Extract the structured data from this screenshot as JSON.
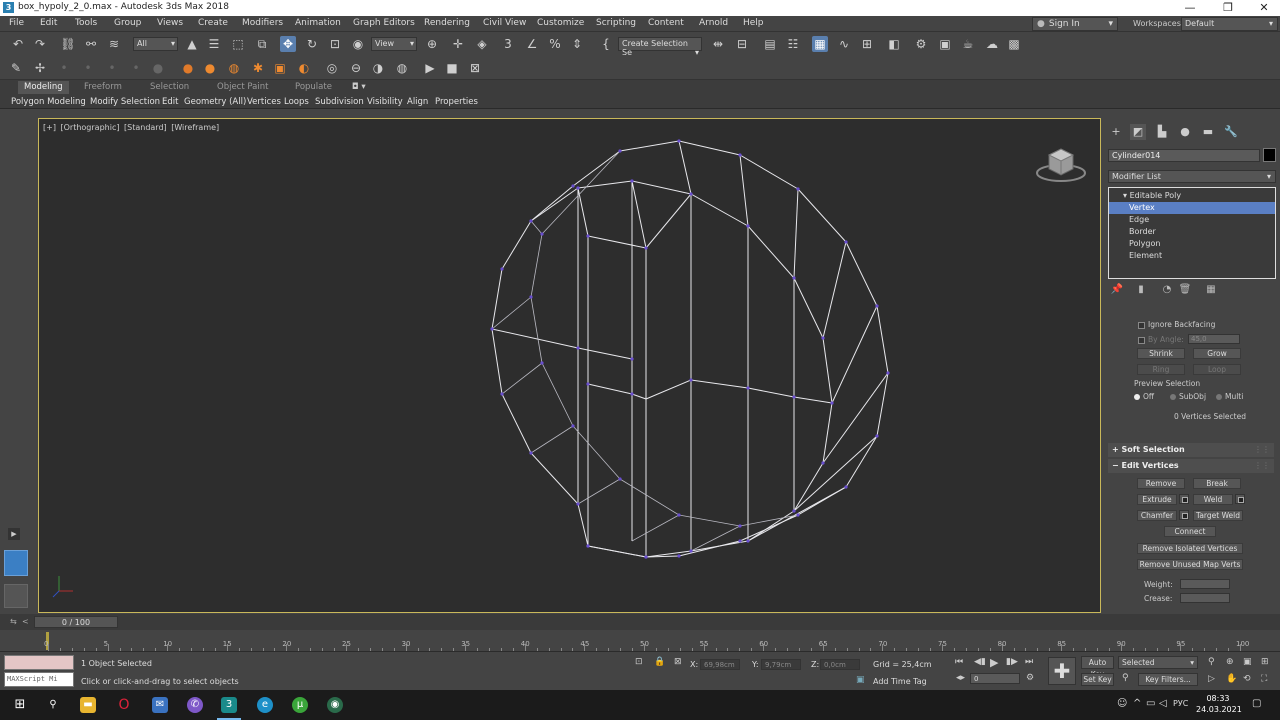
{
  "window": {
    "title": "box_hypoly_2_0.max - Autodesk 3ds Max 2018",
    "app_icon": "3"
  },
  "window_buttons": {
    "minimize": "—",
    "restore": "❐",
    "close": "✕"
  },
  "menu": [
    "File",
    "Edit",
    "Tools",
    "Group",
    "Views",
    "Create",
    "Modifiers",
    "Animation",
    "Graph Editors",
    "Rendering",
    "Civil View",
    "Customize",
    "Scripting",
    "Content",
    "Arnold",
    "Help"
  ],
  "signin": "Sign In",
  "workspaces_label": "Workspaces:",
  "workspace_value": "Default",
  "toolbar": {
    "selection_filter": "All",
    "ref_coord": "View",
    "named_selection": "Create Selection Se"
  },
  "ribbon_tabs": [
    "Modeling",
    "Freeform",
    "Selection",
    "Object Paint",
    "Populate"
  ],
  "ribbon_items": [
    "Polygon Modeling",
    "Modify Selection",
    "Edit",
    "Geometry (All)",
    "Vertices",
    "Loops",
    "Subdivision",
    "Visibility",
    "Align",
    "Properties"
  ],
  "viewport": {
    "label_plus": "[+]",
    "label_view": "[Orthographic]",
    "label_shading1": "[Standard]",
    "label_shading2": "[Wireframe]",
    "wire_color": "#e8e8ec",
    "vertex_color": "#6a4fd0",
    "border_color": "#c9b85a"
  },
  "command_panel": {
    "object_name": "Cylinder014",
    "modifier_list": "Modifier List",
    "stack": {
      "root": "Editable Poly",
      "items": [
        "Vertex",
        "Edge",
        "Border",
        "Polygon",
        "Element"
      ],
      "selected": "Vertex"
    },
    "selection": {
      "ignore_backfacing": "Ignore Backfacing",
      "by_angle": "By Angle:",
      "by_angle_value": "45,0",
      "shrink": "Shrink",
      "grow": "Grow",
      "ring": "Ring",
      "loop": "Loop",
      "preview_selection": "Preview Selection",
      "preview_off": "Off",
      "preview_subobj": "SubObj",
      "preview_multi": "Multi",
      "status": "0 Vertices Selected"
    },
    "soft_selection": "Soft Selection",
    "edit_vertices": {
      "title": "Edit Vertices",
      "remove": "Remove",
      "break": "Break",
      "extrude": "Extrude",
      "weld": "Weld",
      "chamfer": "Chamfer",
      "target_weld": "Target Weld",
      "connect": "Connect",
      "remove_isolated": "Remove Isolated Vertices",
      "remove_unused": "Remove Unused Map Verts",
      "weight": "Weight:",
      "crease": "Crease:"
    }
  },
  "timeline": {
    "slider": "0 / 100",
    "ticks": [
      "0",
      "5",
      "10",
      "15",
      "20",
      "25",
      "30",
      "35",
      "40",
      "45",
      "50",
      "55",
      "60",
      "65",
      "70",
      "75",
      "80",
      "85",
      "90",
      "95",
      "100"
    ]
  },
  "status": {
    "objects_selected": "1 Object Selected",
    "prompt": "Click or click-and-drag to select objects",
    "maxscript": "MAXScript Mi",
    "x_label": "X:",
    "x_value": "69,98cm",
    "y_label": "Y:",
    "y_value": "9,79cm",
    "z_label": "Z:",
    "z_value": "0,0cm",
    "grid": "Grid = 25,4cm",
    "add_time_tag": "Add Time Tag",
    "frame": "0",
    "auto_key": "Auto Key",
    "set_key": "Set Key",
    "selected": "Selected",
    "key_filters": "Key Filters..."
  },
  "taskbar": {
    "lang": "РУС",
    "time": "08:33",
    "date": "24.03.2021",
    "icons": [
      "windows-icon",
      "search-icon",
      "file-explorer-icon",
      "opera-icon",
      "mail-icon",
      "viber-icon",
      "3dsmax-icon",
      "edge-icon",
      "torrent-icon",
      "chrome-like-icon"
    ]
  }
}
